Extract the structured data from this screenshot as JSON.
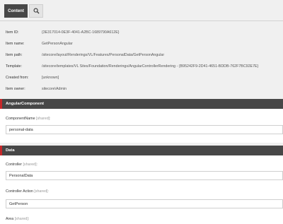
{
  "tabs": {
    "content_label": "Content",
    "search_icon": "search-icon"
  },
  "info": {
    "item_id": {
      "label": "Item ID:",
      "value": "{3E317014-0E3F-4041-A2BC-1689790A612E}"
    },
    "item_name": {
      "label": "Item name:",
      "value": "GetPersonAngular"
    },
    "item_path": {
      "label": "Item path:",
      "value": "/sitecore/layout/Renderings/VL/Features/PersonalData/GetPersonAngular"
    },
    "template": {
      "label": "Template:",
      "value": "/sitecore/templates/VL Sites/Foundation/Renderings/AngularControllerRendering - {B95242F9-2D41-4651-BDDB-762F7BC92E7E}"
    },
    "created_from": {
      "label": "Created from:",
      "value": "[unknown]"
    },
    "item_owner": {
      "label": "Item owner:",
      "value": "sitecore\\Admin"
    }
  },
  "sections": {
    "angular": {
      "title": "AngularComponent",
      "component_name": {
        "label": "ComponentName",
        "shared": "[shared]:",
        "value": "personal-data"
      }
    },
    "data": {
      "title": "Data",
      "controller": {
        "label": "Controller",
        "shared": "[shared]:",
        "value": "PersonalData"
      },
      "controller_action": {
        "label": "Controller Action",
        "shared": "[shared]:",
        "value": "GetPerson"
      },
      "area": {
        "label": "Area",
        "shared": "[shared]:"
      }
    }
  },
  "colors": {
    "header_bg": "#474747",
    "accent": "#c6282a",
    "panel_bg": "#f0f0f0"
  }
}
